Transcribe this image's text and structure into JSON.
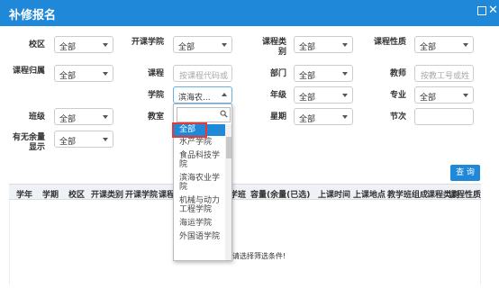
{
  "window": {
    "title": "补修报名"
  },
  "filters": {
    "campus": {
      "label": "校区",
      "value": "全部"
    },
    "open_college": {
      "label": "开课学院",
      "value": "全部"
    },
    "course_category": {
      "label": "课程类别",
      "value": "全部"
    },
    "course_nature": {
      "label": "课程性质",
      "value": "全部"
    },
    "course_belong": {
      "label": "课程归属",
      "value": "全部"
    },
    "course": {
      "label": "课程",
      "placeholder": "按课程代码或"
    },
    "department": {
      "label": "部门",
      "value": "全部"
    },
    "teacher": {
      "label": "教师",
      "placeholder": "按教工号或姓"
    },
    "college": {
      "label": "学院",
      "value": "滨海农..."
    },
    "grade": {
      "label": "年级",
      "value": "全部"
    },
    "major": {
      "label": "专业",
      "value": "全部"
    },
    "class": {
      "label": "班级",
      "value": "全部"
    },
    "classroom": {
      "label": "教室",
      "value": ""
    },
    "weekday": {
      "label": "星期",
      "value": "全部"
    },
    "period": {
      "label": "节次",
      "value": ""
    },
    "remaining": {
      "label": "有无余量显示",
      "value": "全部"
    }
  },
  "query_button": "查 询",
  "table": {
    "headers": [
      "学年",
      "学期",
      "校区",
      "开课类别",
      "开课学院",
      "课程代码",
      "课程名称",
      "教学班",
      "容量(余量(已选)",
      "上课时间",
      "上课地点",
      "教学班组成",
      "课程类别",
      "课程性质",
      "课程"
    ],
    "empty_message": "请选择筛选条件!"
  },
  "dropdown": {
    "options": [
      "全部",
      "水产学院",
      "食品科技学院",
      "滨海农业学院",
      "机械与动力工程学院",
      "海运学院",
      "外国语学院"
    ],
    "selected": "全部"
  }
}
